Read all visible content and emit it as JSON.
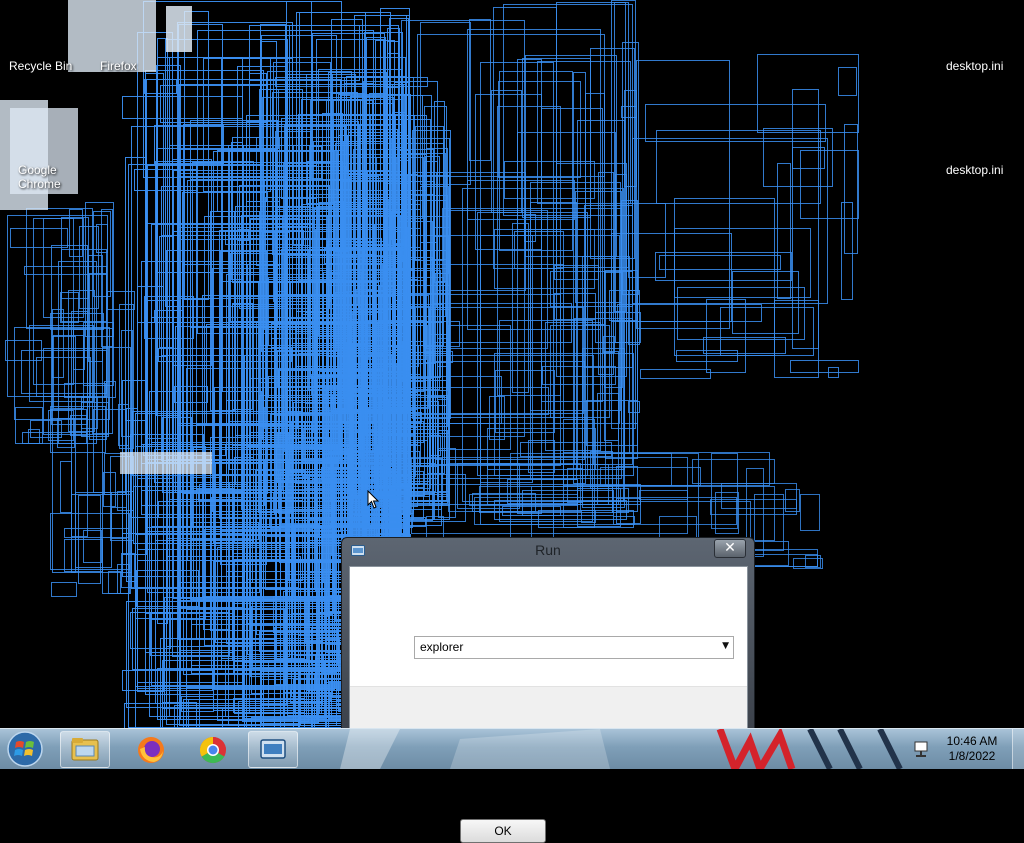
{
  "desktop": {
    "icons": [
      {
        "label": "Recycle Bin"
      },
      {
        "label": "Firefox"
      },
      {
        "label": "desktop.ini"
      },
      {
        "label": "desktop.ini"
      },
      {
        "label": "Google Chrome"
      }
    ]
  },
  "run_dialog": {
    "title": "Run",
    "close_glyph": "✕",
    "combo_value": "explorer",
    "ok_label": "OK"
  },
  "taskbar": {
    "pinned": [
      {
        "name": "windows-explorer-icon"
      },
      {
        "name": "firefox-icon"
      },
      {
        "name": "chrome-icon"
      },
      {
        "name": "run-app-icon"
      }
    ],
    "clock_time": "10:46 AM",
    "clock_date": "1/8/2022"
  },
  "colors": {
    "desktop_bg": "#000000",
    "glitch_lines": "#3a8ef0",
    "taskbar": "#8aa9c2"
  }
}
